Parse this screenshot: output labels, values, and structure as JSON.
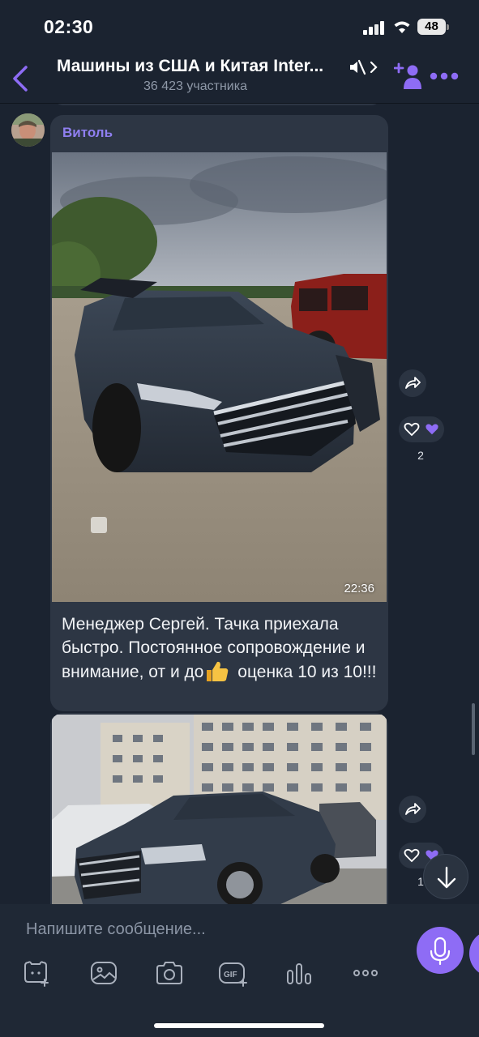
{
  "status_bar": {
    "time": "02:30",
    "battery": "48"
  },
  "header": {
    "title": "Машины из США и Китая Inter...",
    "members": "36 423 участника"
  },
  "message": {
    "sender": "Витоль",
    "photo_time": "22:36",
    "caption": "Менеджер Сергей. Тачка приехала быстро. Постоянное сопровождение и внимание, от и до",
    "caption_end": " оценка 10 из 10!!!",
    "reaction_count": "2"
  },
  "message_2": {
    "reaction_count": "1"
  },
  "composer": {
    "placeholder": "Напишите сообщение..."
  },
  "icons": {
    "back": "chevron-left-icon",
    "mute": "mute-icon",
    "add_member": "add-user-icon",
    "more": "more-horizontal-icon",
    "share": "share-icon",
    "heart": "heart-icon",
    "scroll_down": "arrow-down-icon",
    "mic": "mic-icon",
    "toolbar": [
      "sticker-icon",
      "gallery-icon",
      "camera-icon",
      "gif-icon",
      "poll-icon",
      "more-icon"
    ]
  },
  "colors": {
    "accent": "#8e6cf5",
    "background": "#1b2330",
    "bubble": "#2d3644",
    "sender": "#8f7ff0"
  }
}
